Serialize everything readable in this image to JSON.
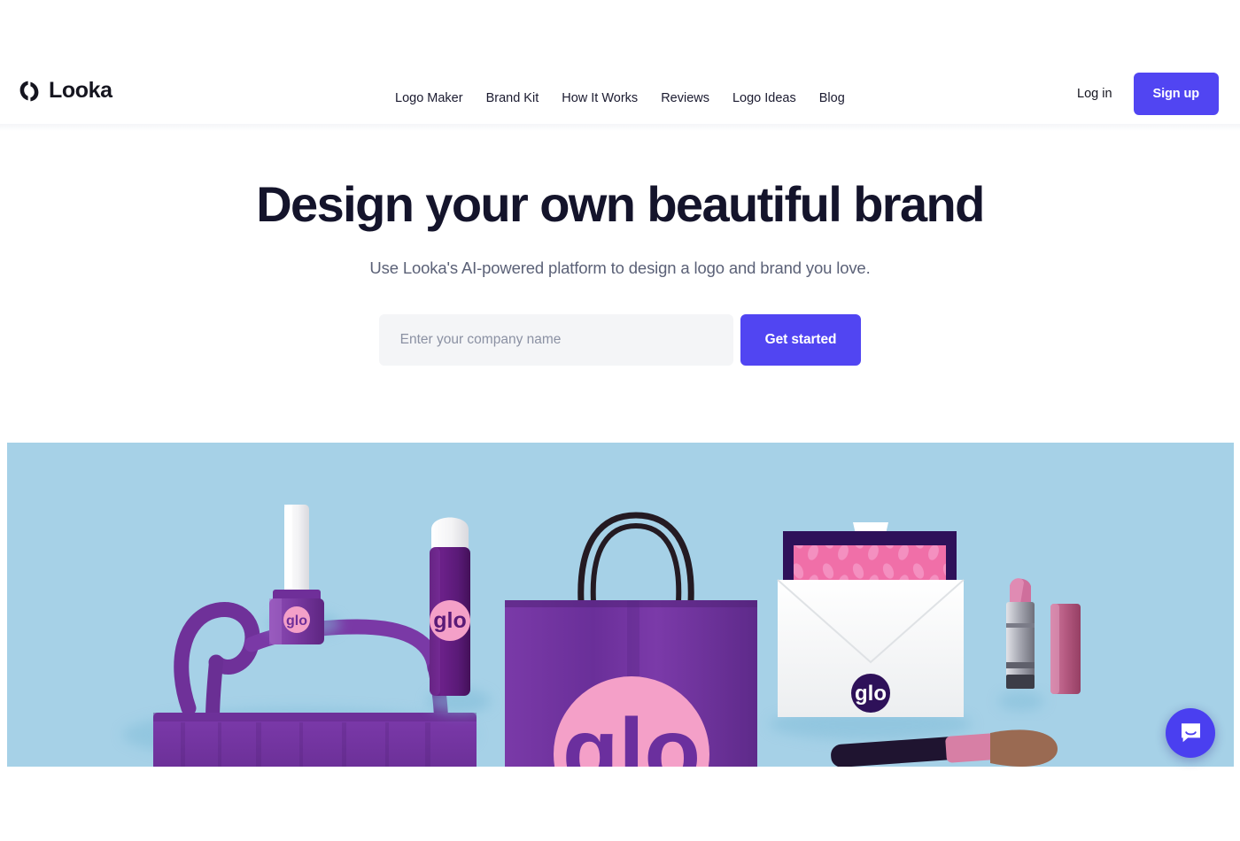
{
  "site": {
    "brand_name": "Looka",
    "brand_icon": "looka-logo-icon"
  },
  "header": {
    "nav": [
      {
        "label": "Logo Maker"
      },
      {
        "label": "Brand Kit"
      },
      {
        "label": "How It Works"
      },
      {
        "label": "Reviews"
      },
      {
        "label": "Logo Ideas"
      },
      {
        "label": "Blog"
      }
    ],
    "login_label": "Log in",
    "signup_label": "Sign up"
  },
  "hero": {
    "title": "Design your own beautiful brand",
    "subtitle": "Use Looka's AI-powered platform to design a logo and brand you love.",
    "input_placeholder": "Enter your company name",
    "input_value": "",
    "cta_label": "Get started"
  },
  "hero_image": {
    "alt": "Purple and pink 'glo' cosmetics brand mockups on a light blue background",
    "background_color": "#a8d3e8",
    "brand_text": "glo",
    "items": [
      "nail-polish-bottle",
      "spray-bottle",
      "tote-bag",
      "shopping-bag",
      "envelope-with-card",
      "lipstick",
      "makeup-brush"
    ]
  },
  "chat": {
    "icon": "chat-bubble-icon",
    "accent_color": "#4a3ff0"
  },
  "colors": {
    "accent": "#5145f2",
    "text_dark": "#14142b",
    "text_muted": "#5b6177",
    "input_bg": "#f4f5f7",
    "hero_bg": "#a8d3e8",
    "brand_purple": "#6b2f9e",
    "brand_pink": "#f7a0cd",
    "brand_deep_purple": "#2e1159"
  }
}
